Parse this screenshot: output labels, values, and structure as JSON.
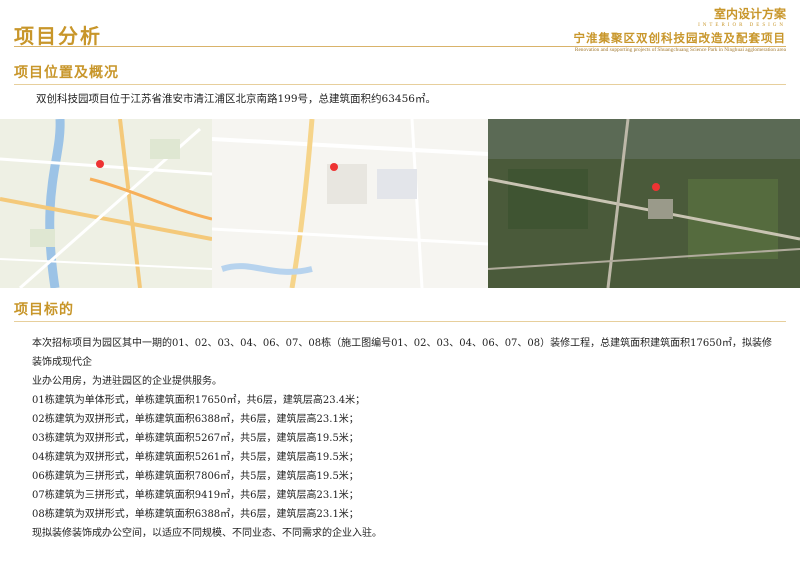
{
  "header": {
    "title": "项目分析",
    "right_main": "室内设计方案",
    "right_sub": "INTERIOR DESIGN",
    "project_name": "宁淮集聚区双创科技园改造及配套项目",
    "project_en": "Renovation and supporting projects of Shuangchuang Science Park in Ninghuai agglomeration area"
  },
  "section1": {
    "title": "项目位置及概况",
    "text": "双创科技园项目位于江苏省淮安市清江浦区北京南路199号，总建筑面积约63456㎡。"
  },
  "maps": {
    "icons": [
      "road-map",
      "street-map",
      "satellite-map"
    ]
  },
  "section2": {
    "title": "项目标的",
    "lines": [
      "本次招标项目为园区其中一期的01、02、03、04、06、07、08栋（施工图编号01、02、03、04、06、07、08）装修工程，总建筑面积建筑面积17650㎡，拟装修装饰成现代企",
      "业办公用房，为进驻园区的企业提供服务。",
      "01栋建筑为单体形式，单栋建筑面积17650㎡，共6层，建筑层高23.4米；",
      "02栋建筑为双拼形式，单栋建筑面积6388㎡，共6层，建筑层高23.1米；",
      "03栋建筑为双拼形式，单栋建筑面积5267㎡，共5层，建筑层高19.5米；",
      "04栋建筑为双拼形式，单栋建筑面积5261㎡，共5层，建筑层高19.5米；",
      "06栋建筑为三拼形式，单栋建筑面积7806㎡，共5层，建筑层高19.5米；",
      "07栋建筑为三拼形式，单栋建筑面积9419㎡，共6层，建筑层高23.1米；",
      "08栋建筑为双拼形式，单栋建筑面积6388㎡，共6层，建筑层高23.1米；",
      "现拟装修装饰成办公空间，以适应不同规模、不同业态、不同需求的企业入驻。"
    ]
  },
  "colors": {
    "accent": "#c8962a"
  }
}
